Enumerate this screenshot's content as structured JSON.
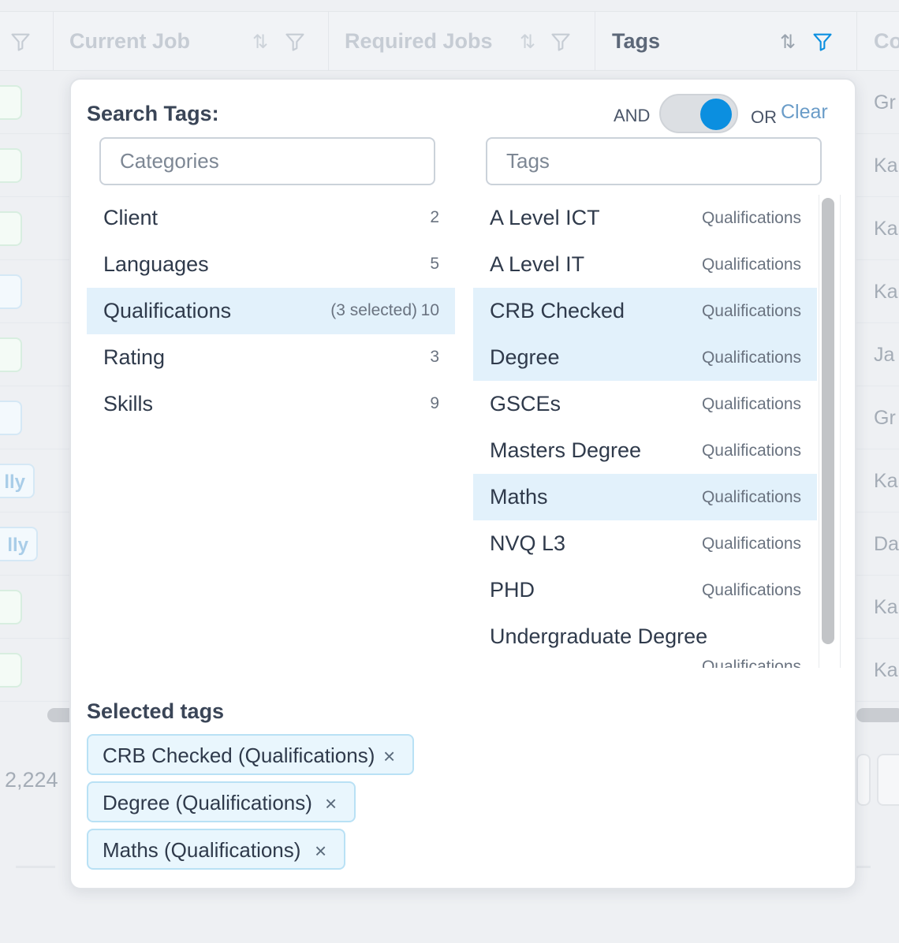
{
  "table": {
    "columns": [
      {
        "label": "Current Job"
      },
      {
        "label": "Required Jobs"
      },
      {
        "label": "Tags"
      },
      {
        "label": "Co"
      }
    ],
    "partial_pill_labels": [
      "lly",
      "lly"
    ],
    "right_column_values": [
      "Gr",
      "Ka",
      "Ka",
      "Ka",
      "Ja",
      "Gr",
      "Ka",
      "Da",
      "Ka",
      "Ka"
    ],
    "total_count": "2,224"
  },
  "popup": {
    "title": "Search Tags:",
    "mode": {
      "and_label": "AND",
      "or_label": "OR",
      "selected": "OR"
    },
    "clear_label": "Clear",
    "categories_placeholder": "Categories",
    "tags_placeholder": "Tags",
    "categories": [
      {
        "name": "Client",
        "count": "2",
        "selected_text": ""
      },
      {
        "name": "Languages",
        "count": "5",
        "selected_text": ""
      },
      {
        "name": "Qualifications",
        "count": "10",
        "selected_text": "(3 selected)"
      },
      {
        "name": "Rating",
        "count": "3",
        "selected_text": ""
      },
      {
        "name": "Skills",
        "count": "9",
        "selected_text": ""
      }
    ],
    "tags": [
      {
        "name": "A Level ICT",
        "category": "Qualifications"
      },
      {
        "name": "A Level IT",
        "category": "Qualifications"
      },
      {
        "name": "CRB Checked",
        "category": "Qualifications"
      },
      {
        "name": "Degree",
        "category": "Qualifications"
      },
      {
        "name": "GSCEs",
        "category": "Qualifications"
      },
      {
        "name": "Masters Degree",
        "category": "Qualifications"
      },
      {
        "name": "Maths",
        "category": "Qualifications"
      },
      {
        "name": "NVQ L3",
        "category": "Qualifications"
      },
      {
        "name": "PHD",
        "category": "Qualifications"
      },
      {
        "name": "Undergraduate Degree",
        "category": "Qualifications"
      }
    ],
    "selected_title": "Selected tags",
    "selected_tags": [
      {
        "label": "CRB Checked (Qualifications)"
      },
      {
        "label": "Degree (Qualifications)"
      },
      {
        "label": "Maths (Qualifications)"
      }
    ],
    "remove_glyph": "×"
  },
  "colors": {
    "accent": "#0b8fe0",
    "selected_bg": "#e2f1fb",
    "chip_border": "#b9e1f5"
  }
}
